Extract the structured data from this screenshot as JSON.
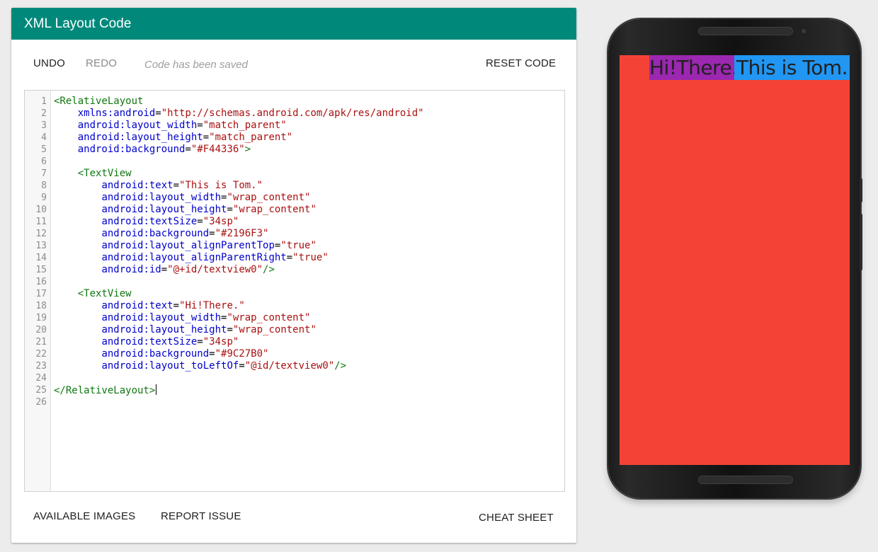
{
  "header": {
    "title": "XML Layout Code",
    "color": "#00897b"
  },
  "toolbar": {
    "undo_label": "UNDO",
    "redo_label": "REDO",
    "status": "Code has been saved",
    "reset_label": "RESET CODE"
  },
  "editor": {
    "line_numbers": [
      "1",
      "2",
      "3",
      "4",
      "5",
      "6",
      "7",
      "8",
      "9",
      "10",
      "11",
      "12",
      "13",
      "14",
      "15",
      "16",
      "17",
      "18",
      "19",
      "20",
      "21",
      "22",
      "23",
      "24",
      "25",
      "26"
    ],
    "lines": [
      [
        [
          "tag",
          "<RelativeLayout"
        ]
      ],
      [
        [
          "plain",
          "    "
        ],
        [
          "attr",
          "xmlns:android"
        ],
        [
          "plain",
          "="
        ],
        [
          "str",
          "\"http://schemas.android.com/apk/res/android\""
        ]
      ],
      [
        [
          "plain",
          "    "
        ],
        [
          "attr",
          "android:layout_width"
        ],
        [
          "plain",
          "="
        ],
        [
          "str",
          "\"match_parent\""
        ]
      ],
      [
        [
          "plain",
          "    "
        ],
        [
          "attr",
          "android:layout_height"
        ],
        [
          "plain",
          "="
        ],
        [
          "str",
          "\"match_parent\""
        ]
      ],
      [
        [
          "plain",
          "    "
        ],
        [
          "attr",
          "android:background"
        ],
        [
          "plain",
          "="
        ],
        [
          "str",
          "\"#F44336\""
        ],
        [
          "tag",
          ">"
        ]
      ],
      [],
      [
        [
          "plain",
          "    "
        ],
        [
          "tag",
          "<TextView"
        ]
      ],
      [
        [
          "plain",
          "        "
        ],
        [
          "attr",
          "android:text"
        ],
        [
          "plain",
          "="
        ],
        [
          "str",
          "\"This is Tom.\""
        ]
      ],
      [
        [
          "plain",
          "        "
        ],
        [
          "attr",
          "android:layout_width"
        ],
        [
          "plain",
          "="
        ],
        [
          "str",
          "\"wrap_content\""
        ]
      ],
      [
        [
          "plain",
          "        "
        ],
        [
          "attr",
          "android:layout_height"
        ],
        [
          "plain",
          "="
        ],
        [
          "str",
          "\"wrap_content\""
        ]
      ],
      [
        [
          "plain",
          "        "
        ],
        [
          "attr",
          "android:textSize"
        ],
        [
          "plain",
          "="
        ],
        [
          "str",
          "\"34sp\""
        ]
      ],
      [
        [
          "plain",
          "        "
        ],
        [
          "attr",
          "android:background"
        ],
        [
          "plain",
          "="
        ],
        [
          "str",
          "\"#2196F3\""
        ]
      ],
      [
        [
          "plain",
          "        "
        ],
        [
          "attr",
          "android:layout_alignParentTop"
        ],
        [
          "plain",
          "="
        ],
        [
          "str",
          "\"true\""
        ]
      ],
      [
        [
          "plain",
          "        "
        ],
        [
          "attr",
          "android:layout_alignParentRight"
        ],
        [
          "plain",
          "="
        ],
        [
          "str",
          "\"true\""
        ]
      ],
      [
        [
          "plain",
          "        "
        ],
        [
          "attr",
          "android:id"
        ],
        [
          "plain",
          "="
        ],
        [
          "str",
          "\"@+id/textview0\""
        ],
        [
          "tag",
          "/>"
        ]
      ],
      [],
      [
        [
          "plain",
          "    "
        ],
        [
          "tag",
          "<TextView"
        ]
      ],
      [
        [
          "plain",
          "        "
        ],
        [
          "attr",
          "android:text"
        ],
        [
          "plain",
          "="
        ],
        [
          "str",
          "\"Hi!There.\""
        ]
      ],
      [
        [
          "plain",
          "        "
        ],
        [
          "attr",
          "android:layout_width"
        ],
        [
          "plain",
          "="
        ],
        [
          "str",
          "\"wrap_content\""
        ]
      ],
      [
        [
          "plain",
          "        "
        ],
        [
          "attr",
          "android:layout_height"
        ],
        [
          "plain",
          "="
        ],
        [
          "str",
          "\"wrap_content\""
        ]
      ],
      [
        [
          "plain",
          "        "
        ],
        [
          "attr",
          "android:textSize"
        ],
        [
          "plain",
          "="
        ],
        [
          "str",
          "\"34sp\""
        ]
      ],
      [
        [
          "plain",
          "        "
        ],
        [
          "attr",
          "android:background"
        ],
        [
          "plain",
          "="
        ],
        [
          "str",
          "\"#9C27B0\""
        ]
      ],
      [
        [
          "plain",
          "        "
        ],
        [
          "attr",
          "android:layout_toLeftOf"
        ],
        [
          "plain",
          "="
        ],
        [
          "str",
          "\"@id/textview0\""
        ],
        [
          "tag",
          "/>"
        ]
      ],
      [],
      [
        [
          "tag",
          "</RelativeLayout>"
        ]
      ],
      []
    ],
    "cursor_line": 25,
    "colors": {
      "tag": "#117711",
      "attr": "#0000cc",
      "str": "#aa1111"
    }
  },
  "footer": {
    "images_label": "AVAILABLE IMAGES",
    "report_label": "REPORT ISSUE",
    "cheat_label": "CHEAT SHEET"
  },
  "preview": {
    "background": "#F44336",
    "textview0": {
      "text": "This is Tom.",
      "background": "#2196F3"
    },
    "textview1": {
      "text": "Hi!There.",
      "background": "#9C27B0"
    }
  }
}
